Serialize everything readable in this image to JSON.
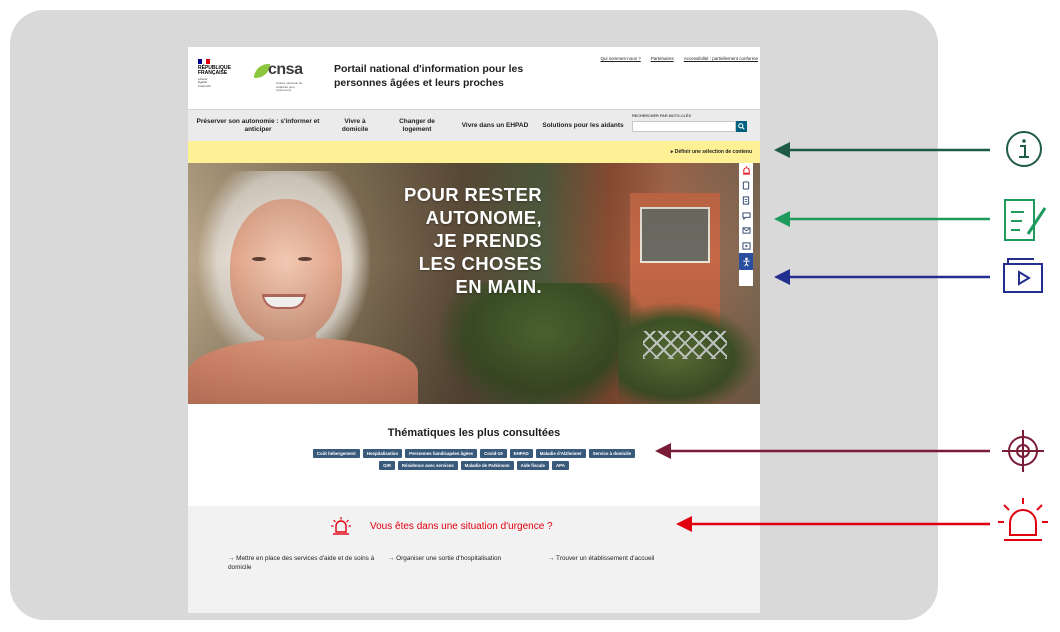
{
  "header": {
    "republique": "RÉPUBLIQUE\nFRANÇAISE",
    "motto": "Liberté\nÉgalité\nFraternité",
    "logo_text": "cnsa",
    "logo_subtitle": "Caisse nationale de solidarité pour l'autonomie",
    "portal_title": "Portail national d'information pour les personnes âgées et leurs proches",
    "top_links": [
      "Qui sommes-nous ?",
      "Partenaires",
      "Accessibilité : partiellement conforme"
    ]
  },
  "nav": {
    "items": [
      "Préserver son autonomie : s'informer et anticiper",
      "Vivre à domicile",
      "Changer de logement",
      "Vivre dans un EHPAD",
      "Solutions pour les aidants"
    ],
    "search_label": "RECHERCHER PAR MOTS-CLÉS"
  },
  "banner": {
    "link": "▸ Définir une sélection de contenu"
  },
  "hero": {
    "lines": [
      "POUR RESTER",
      "AUTONOME,",
      "JE PRENDS",
      "LES CHOSES",
      "EN MAIN."
    ]
  },
  "themes": {
    "title": "Thématiques les plus consultées",
    "tags": [
      "Coût hébergement",
      "Hospitalisation",
      "Personnes handicapées âgées",
      "Covid-19",
      "EHPAD",
      "Maladie d'Alzheimer",
      "Service à domicile",
      "GIR",
      "Résidence avec services",
      "Maladie de Parkinson",
      "Aide fiscale",
      "APA"
    ]
  },
  "urgence": {
    "title": "Vous êtes dans une situation d'urgence ?",
    "links": [
      "→ Mettre en place des services d'aide et de soins à domicile",
      "→ Organiser une sortie d'hospitalisation",
      "→ Trouver un établissement d'accueil"
    ]
  },
  "colors": {
    "frame": "#d9d9d9",
    "banner": "#fef195",
    "tag": "#3a5a7c",
    "urgence_red": "#e1000f",
    "arrow_dark_green": "#1d5b45",
    "arrow_green": "#1f9a5d",
    "arrow_navy": "#232f8e",
    "arrow_maroon": "#7a1c37",
    "arrow_red": "#e1000f"
  },
  "annotations": [
    "info-icon",
    "form-edit-icon",
    "video-player-icon",
    "target-icon",
    "siren-icon"
  ]
}
